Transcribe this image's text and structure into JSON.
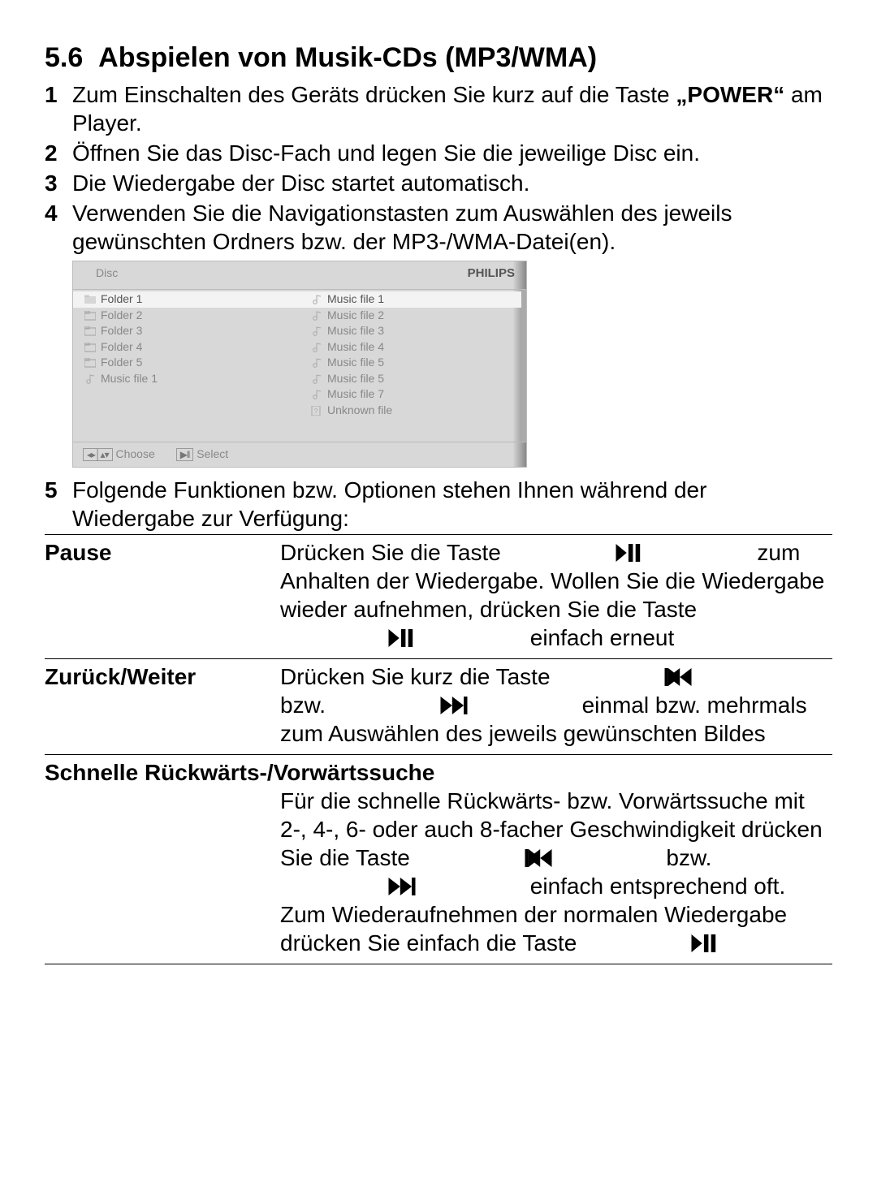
{
  "section": {
    "number": "5.6",
    "title": "Abspielen von Musik-CDs (MP3/WMA)"
  },
  "steps": {
    "s1a": "Zum Einschalten des Geräts drücken Sie kurz auf die Taste ",
    "s1b": "„POWER“",
    "s1c": " am Player.",
    "s2": "Öffnen Sie das Disc-Fach und legen Sie die jeweilige Disc ein.",
    "s3": "Die Wiedergabe der Disc startet automatisch.",
    "s4": "Verwenden Sie die Navigationstasten zum Auswählen des jeweils gewünschten Ordners bzw. der MP3-/WMA-Datei(en).",
    "s5": "Folgende Funktionen bzw. Optionen stehen Ihnen während der Wiedergabe zur Verfügung:"
  },
  "ui": {
    "disc": "Disc",
    "brand": "PHILIPS",
    "left": [
      {
        "icon": "folder-open",
        "label": "Folder 1",
        "hl": true
      },
      {
        "icon": "folder",
        "label": "Folder 2"
      },
      {
        "icon": "folder",
        "label": "Folder 3"
      },
      {
        "icon": "folder",
        "label": "Folder 4"
      },
      {
        "icon": "folder",
        "label": "Folder 5"
      },
      {
        "icon": "music",
        "label": "Music file 1"
      }
    ],
    "right": [
      {
        "icon": "music",
        "label": "Music file 1",
        "hl": true
      },
      {
        "icon": "music",
        "label": "Music file 2"
      },
      {
        "icon": "music",
        "label": "Music file 3"
      },
      {
        "icon": "music",
        "label": "Music file 4"
      },
      {
        "icon": "music",
        "label": "Music file 5"
      },
      {
        "icon": "music",
        "label": "Music file 5"
      },
      {
        "icon": "music",
        "label": "Music file 7"
      },
      {
        "icon": "unknown",
        "label": "Unknown file"
      }
    ],
    "foot": {
      "choose_key": "◂▸│▴▾",
      "choose": "Choose",
      "select_key": "▶ll",
      "select": "Select"
    }
  },
  "fn": {
    "pause": {
      "term": "Pause",
      "d1": "Drücken Sie die Taste ",
      "d2": " zum Anhalten der Wiedergabe. Wollen Sie die Wiedergabe wieder aufnehmen, drücken Sie die Taste ",
      "d3": " einfach erneut"
    },
    "prevnext": {
      "term": "Zurück/Weiter",
      "d1": "Drücken Sie kurz die Taste ",
      "d2": " bzw. ",
      "d3": " einmal bzw. mehrmals zum Auswählen des jeweils gewünschten Bildes"
    },
    "search": {
      "term": "Schnelle Rückwärts-/Vorwärtssuche",
      "d1": "Für die schnelle Rückwärts- bzw. Vorwärtssuche mit 2-, 4-, 6- oder auch 8-facher Geschwindigkeit drücken Sie die Taste ",
      "d2": " bzw. ",
      "d3": " einfach entsprechend oft. Zum Wiederaufnehmen der normalen Wiedergabe drücken Sie einfach die Taste "
    }
  }
}
